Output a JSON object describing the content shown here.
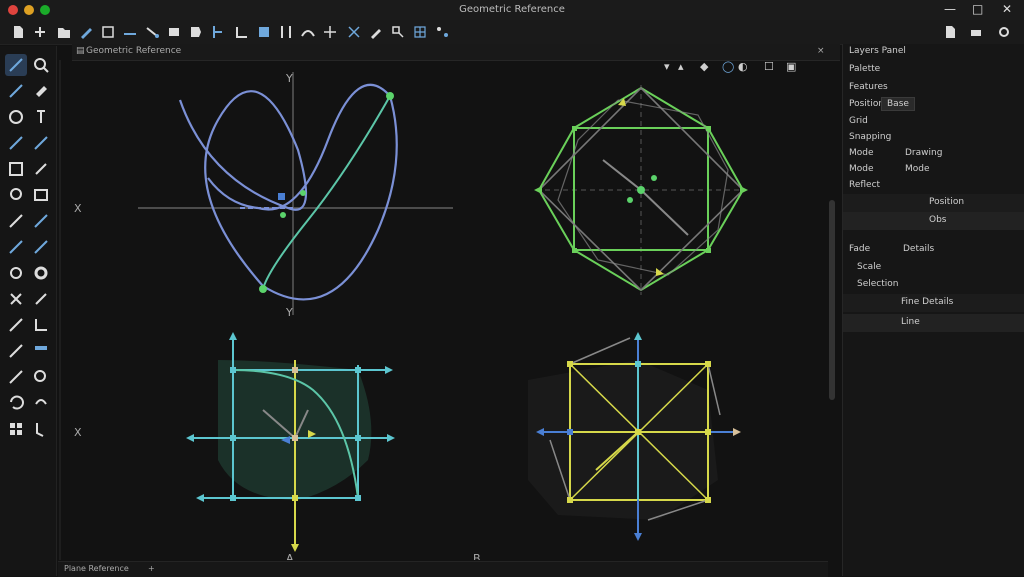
{
  "window": {
    "title": "Geometric Reference",
    "controls": [
      "—",
      "□",
      "✕"
    ],
    "traffic_colors": [
      "#e0443e",
      "#dea123",
      "#1aab29"
    ]
  },
  "doc": {
    "tab_label": "Geometric Reference",
    "close": "×"
  },
  "view_toolbar": {
    "items": [
      "▾",
      "▴",
      "◆",
      "◯",
      "◐",
      "☐",
      "▣"
    ]
  },
  "canvas_labels": {
    "axis_top": "Y",
    "axis_bottom": "Y",
    "axis_left": "X",
    "axis_left2": "X",
    "bottom_a": "A",
    "bottom_b": "B"
  },
  "status": {
    "label": "Plane Reference",
    "sep": "+"
  },
  "right_panel": {
    "header": "Layers Panel",
    "section": "Palette",
    "items": [
      {
        "label": "Features"
      },
      {
        "label": "Position",
        "value": "Base"
      },
      {
        "label": "Grid"
      },
      {
        "label": "Snapping"
      },
      {
        "label": "Mode",
        "value": "Drawing"
      },
      {
        "label": "Mode",
        "value": "Mode"
      },
      {
        "label": "Reflect"
      }
    ],
    "layer_rows": [
      {
        "label": "Position"
      },
      {
        "label": "Obs"
      }
    ],
    "tabs": [
      "Fade",
      "Details"
    ],
    "sections2": [
      "Scale",
      "Selection"
    ],
    "sel_rows": [
      {
        "label": "Fine Details"
      },
      {
        "label": "Line"
      }
    ]
  }
}
